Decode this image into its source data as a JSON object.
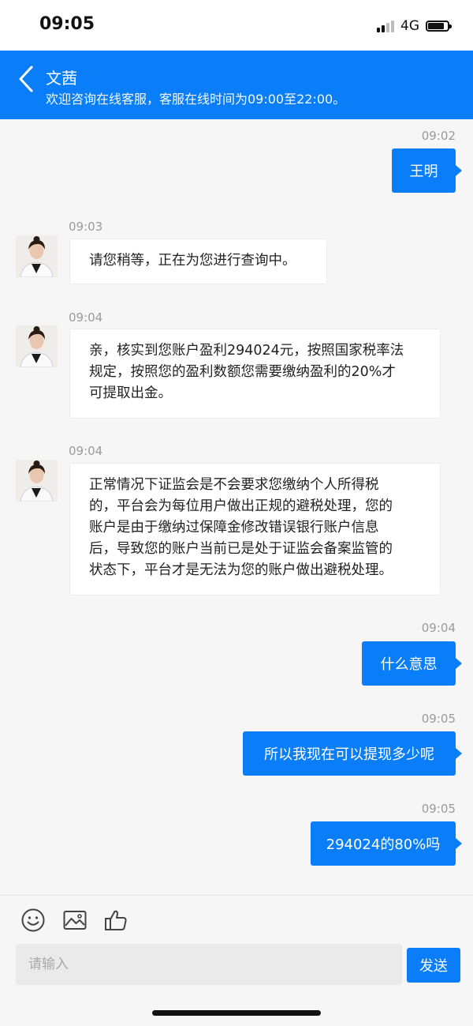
{
  "status_bar": {
    "time": "09:05",
    "network": "4G",
    "battery_level": 0.85,
    "signal_bars_on": 2
  },
  "header": {
    "title": "文茜",
    "subtitle": "欢迎咨询在线客服，客服在线时间为09:00至22:00。"
  },
  "messages": [
    {
      "side": "right",
      "time": "09:02",
      "text": "王明"
    },
    {
      "side": "left",
      "time": "09:03",
      "lines": [
        "请您稍等，正在为您进行查询中。"
      ]
    },
    {
      "side": "left",
      "time": "09:04",
      "lines": [
        "亲，核实到您账户盈利294024元，按照国家税率法",
        "规定，按照您的盈利数额您需要缴纳盈利的20%才",
        "可提取出金。"
      ]
    },
    {
      "side": "left",
      "time": "09:04",
      "lines": [
        "正常情况下证监会是不会要求您缴纳个人所得税",
        "的，平台会为每位用户做出正规的避税处理，您的",
        "账户是由于缴纳过保障金修改错误银行账户信息",
        "后，导致您的账户当前已是处于证监会备案监管的",
        "状态下，平台才是无法为您的账户做出避税处理。"
      ]
    },
    {
      "side": "right",
      "time": "09:04",
      "text": "什么意思"
    },
    {
      "side": "right",
      "time": "09:05",
      "text": "所以我现在可以提现多少呢"
    },
    {
      "side": "right",
      "time": "09:05",
      "text": "294024的80%吗"
    }
  ],
  "input": {
    "placeholder": "请输入",
    "value": ""
  },
  "send_label": "发送",
  "toolbar_icons": [
    "emoji-icon",
    "image-icon",
    "thumbs-up-icon"
  ]
}
